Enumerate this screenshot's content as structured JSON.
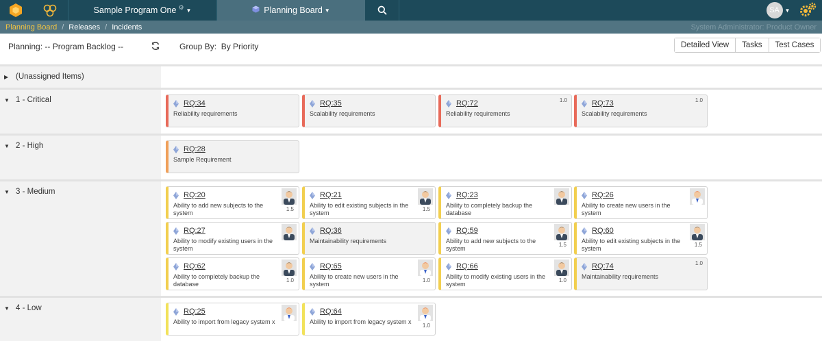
{
  "colors": {
    "nav": "#1d4a5a",
    "nav_active": "#4a6f7e",
    "crumbbar": "#517482",
    "crumb_active": "#f4c542",
    "priority_critical": "#e86a5a",
    "priority_high": "#f0a05a",
    "priority_medium": "#f2cf4f",
    "priority_low": "#f2e25a"
  },
  "nav": {
    "logo_icon": "spira-logo-icon",
    "program_icon": "program-rings-icon",
    "program": "Sample Program One",
    "program_settings_icon": "gear-icon",
    "board_icon": "cube-icon",
    "board": "Planning Board",
    "search_icon": "search-icon",
    "avatar": "SA",
    "gears_icon": "gears-icon"
  },
  "breadcrumb": {
    "items": [
      "Planning Board",
      "Releases",
      "Incidents"
    ],
    "user_role": "System Administrator: Product Owner"
  },
  "toolbar": {
    "planning": "Planning: -- Program Backlog --",
    "refresh_icon": "refresh-icon",
    "group_by": "Group By:  By Priority",
    "views": [
      "Detailed View",
      "Tasks",
      "Test Cases"
    ]
  },
  "groups": [
    {
      "label": "(Unassigned Items)",
      "cards": []
    },
    {
      "label": "1 - Critical",
      "priority": "critical",
      "cards": [
        {
          "id": "RQ:34",
          "name": "Reliability requirements",
          "points": "",
          "owner": false
        },
        {
          "id": "RQ:35",
          "name": "Scalability requirements",
          "points": "",
          "owner": false
        },
        {
          "id": "RQ:72",
          "name": "Reliability requirements",
          "points": "1.0",
          "owner": false
        },
        {
          "id": "RQ:73",
          "name": "Scalability requirements",
          "points": "1.0",
          "owner": false
        }
      ]
    },
    {
      "label": "2 - High",
      "priority": "high",
      "cards": [
        {
          "id": "RQ:28",
          "name": "Sample Requirement",
          "points": "",
          "owner": false
        }
      ]
    },
    {
      "label": "3 - Medium",
      "priority": "medium",
      "cards": [
        {
          "id": "RQ:20",
          "name": "Ability to add new subjects to the system",
          "points": "1.5",
          "owner": true,
          "hair": "dark"
        },
        {
          "id": "RQ:21",
          "name": "Ability to edit existing subjects in the system",
          "points": "1.5",
          "owner": true,
          "hair": "dark"
        },
        {
          "id": "RQ:23",
          "name": "Ability to completely backup the database",
          "points": "",
          "owner": true,
          "hair": "dark"
        },
        {
          "id": "RQ:26",
          "name": "Ability to create new users in the system",
          "points": "",
          "owner": true,
          "hair": "red"
        },
        {
          "id": "RQ:27",
          "name": "Ability to modify existing users in the system",
          "points": "",
          "owner": true,
          "hair": "dark"
        },
        {
          "id": "RQ:36",
          "name": "Maintainability requirements",
          "points": "",
          "owner": false
        },
        {
          "id": "RQ:59",
          "name": "Ability to add new subjects to the system",
          "points": "1.5",
          "owner": true,
          "hair": "dark"
        },
        {
          "id": "RQ:60",
          "name": "Ability to edit existing subjects in the system",
          "points": "1.5",
          "owner": true,
          "hair": "dark"
        },
        {
          "id": "RQ:62",
          "name": "Ability to completely backup the database",
          "points": "1.0",
          "owner": true,
          "hair": "dark"
        },
        {
          "id": "RQ:65",
          "name": "Ability to create new users in the system",
          "points": "1.0",
          "owner": true,
          "hair": "red"
        },
        {
          "id": "RQ:66",
          "name": "Ability to modify existing users in the system",
          "points": "1.0",
          "owner": true,
          "hair": "dark"
        },
        {
          "id": "RQ:74",
          "name": "Maintainability requirements",
          "points": "1.0",
          "owner": false
        }
      ]
    },
    {
      "label": "4 - Low",
      "priority": "low",
      "cards": [
        {
          "id": "RQ:25",
          "name": "Ability to import from legacy system x",
          "points": "",
          "owner": true,
          "hair": "red"
        },
        {
          "id": "RQ:64",
          "name": "Ability to import from legacy system x",
          "points": "1.0",
          "owner": true,
          "hair": "red"
        }
      ]
    }
  ]
}
